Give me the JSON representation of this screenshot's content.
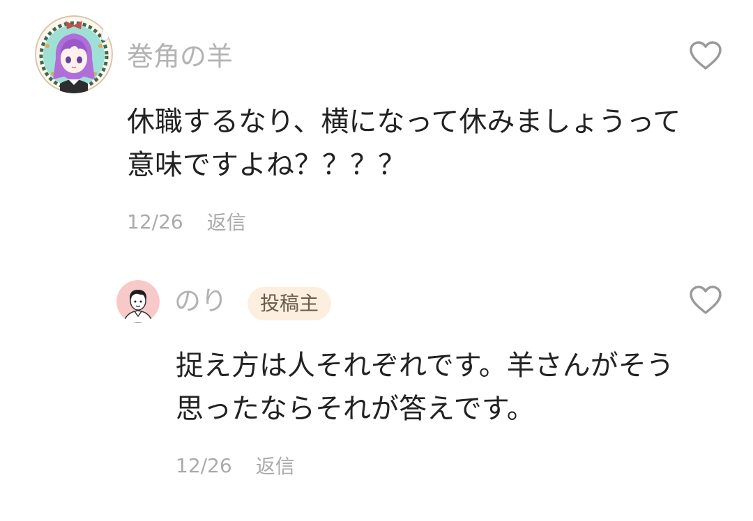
{
  "comments": [
    {
      "username": "巻角の羊",
      "avatar_icon": "anime-girl-avatar-icon",
      "text_lines": [
        "休職するなり、横になって休みましょうって",
        "意味ですよね？？？？"
      ],
      "date": "12/26",
      "reply_label": "返信",
      "like_icon": "heart-outline-icon"
    },
    {
      "username": "のり",
      "avatar_icon": "man-avatar-icon",
      "badge": "投稿主",
      "text_lines": [
        "捉え方は人それぞれです。羊さんがそう",
        "思ったならそれが答えです。"
      ],
      "date": "12/26",
      "reply_label": "返信",
      "like_icon": "heart-outline-icon"
    }
  ],
  "colors": {
    "username": "#b3b3b3",
    "body_text": "#222222",
    "meta": "#aaaaaa",
    "heart_stroke": "#9a9a9a",
    "badge_bg": "#fcefdf",
    "badge_text": "#6b5a48"
  }
}
